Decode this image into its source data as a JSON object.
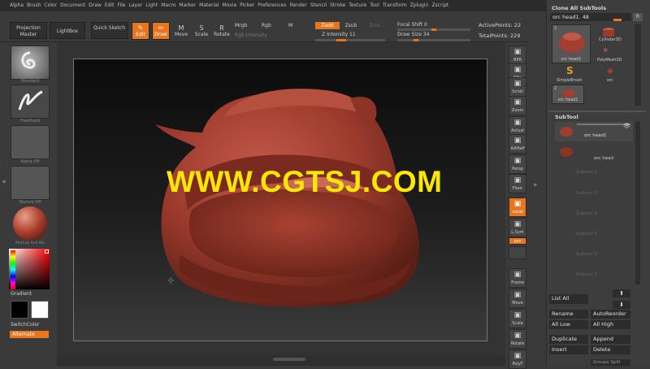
{
  "menu": [
    "Alpha",
    "Brush",
    "Color",
    "Document",
    "Draw",
    "Edit",
    "File",
    "Layer",
    "Light",
    "Macro",
    "Marker",
    "Material",
    "Movie",
    "Picker",
    "Preferences",
    "Render",
    "Stencil",
    "Stroke",
    "Texture",
    "Tool",
    "Transform",
    "Zplugin",
    "Zscript"
  ],
  "toolbar": {
    "projection_master": "Projection Master",
    "lightbox": "LightBox",
    "quick_sketch": "Quick Sketch",
    "edit": "Edit",
    "draw": "Draw",
    "move": "Move",
    "scale": "Scale",
    "rotate": "Rotate",
    "mrgb": "Mrgb",
    "rgb": "Rgb",
    "m": "M",
    "rgb_intensity": "Rgb Intensity",
    "zadd": "Zadd",
    "zsub": "Zsub",
    "zcut": "Zcut",
    "z_intensity": "Z Intensity 11",
    "focal_shift": "Focal Shift 0",
    "draw_size": "Draw Size 34",
    "active_points": "ActivePoints: 22",
    "total_points": "TotalPoints: 229"
  },
  "left_shelf": {
    "brush_label": "Standard",
    "stroke_label": "FreeHand",
    "alpha_label": "Alpha Off",
    "texture_label": "Texture Off",
    "material_label": "MatCap Red Wa",
    "gradient": "Gradient",
    "switch_color": "SwitchColor",
    "alternate": "Alternate"
  },
  "right_shelf": [
    "BPR",
    "SPix",
    "Scroll",
    "Zoom",
    "Actual",
    "AAHalf",
    "Persp",
    "Floor",
    "Local",
    "L.Sym",
    "xyz",
    "",
    "Frame",
    "Move",
    "Scale",
    "Rotate",
    "PolyF"
  ],
  "watermark": "WWW.CGTSJ.COM",
  "tool_panel": {
    "clone_all": "Clone All SubTools",
    "current_tool": "orc head1. 48",
    "r": "R",
    "tools": [
      {
        "name": "orc head1",
        "count": "2"
      },
      {
        "name": "Cylinder3D",
        "count": ""
      },
      {
        "name": "PolyMesh3D",
        "count": ""
      },
      {
        "name": "SimpleBrush",
        "count": ""
      },
      {
        "name": "orc",
        "count": ""
      },
      {
        "name": "orc head1",
        "count": "2"
      }
    ]
  },
  "subtool": {
    "title": "SubTool",
    "items": [
      "orc head1",
      "orc head",
      "Subtool 2",
      "Subtool 3",
      "Subtool 4",
      "Subtool 5",
      "Subtool 6",
      "Subtool 7"
    ],
    "list_all": "List All",
    "rename": "Rename",
    "auto_reorder": "AutoReorder",
    "all_low": "All Low",
    "all_high": "All High",
    "duplicate": "Duplicate",
    "append": "Append",
    "insert": "Insert",
    "delete": "Delete",
    "split": "Groups Split"
  },
  "colors": {
    "accent": "#e8761f",
    "watermark": "#ffe800",
    "model": "#9b3a2c"
  }
}
